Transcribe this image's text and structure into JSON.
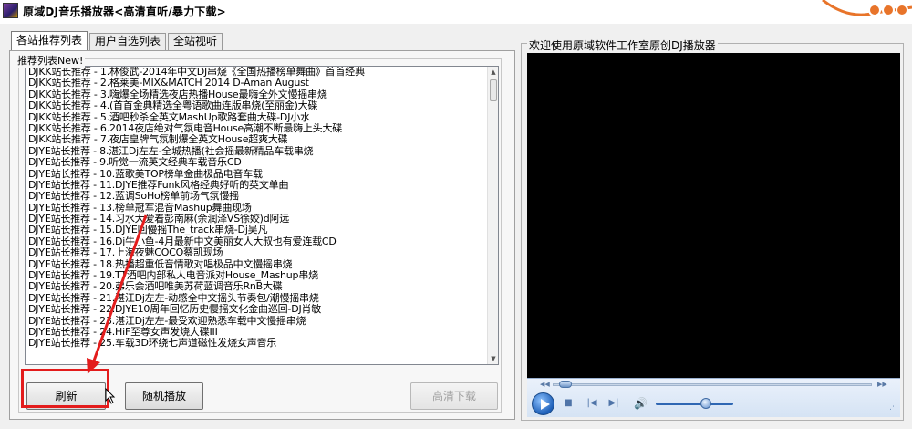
{
  "window": {
    "title": "原域DJ音乐播放器<高清直听/暴力下载>"
  },
  "tabs": [
    {
      "label": "各站推荐列表",
      "active": true
    },
    {
      "label": "用户自选列表",
      "active": false
    },
    {
      "label": "全站视听",
      "active": false
    }
  ],
  "list_group": {
    "legend": "推荐列表New!",
    "items": [
      "DJKK站长推荐 - 1.林俊武-2014年中文DJ串烧《全国热播榜单舞曲》首首经典",
      "DJKK站长推荐 - 2.格莱美-MIX&MATCH 2014 D-Aman August",
      "DJKK站长推荐 - 3.嗨爆全场精选夜店热播House最嗨全外文慢摇串烧",
      "DJKK站长推荐 - 4.(首首金典精选全粤语歌曲连版串烧(至丽金)大碟",
      "DJKK站长推荐 - 5.酒吧秒杀全英文MashUp歌路套曲大碟-DJ小水",
      "DJKK站长推荐 - 6.2014夜店绝对气氛电音House高潮不断最嗨上头大碟",
      "DJKK站长推荐 - 7.夜店皇牌气氛制爆全英文House超爽大碟",
      "DJYE站长推荐 - 8.湛江Dj左左-全城热播(社会摇最新精品车载串烧",
      "DJYE站长推荐 - 9.听觉一流英文经典车载音乐CD",
      "DJYE站长推荐 - 10.蓝歌美TOP榜单金曲极品电音车载",
      "DJYE站长推荐 - 11.DJYE推荐Funk风格经典好听的英文单曲",
      "DJYE站长推荐 - 12.蓝调SoHo榜单前场气氛慢摇",
      "DJYE站长推荐 - 13.榜单冠军混音Mashup舞曲现场",
      "DJYE站长推荐 - 14.习水大爱着彭南麻(余润泽VS徐姣)d阿远",
      "DJYE站长推荐 - 15.DJYE回慢摇The_track串烧-Dj吴凡",
      "DJYE站长推荐 - 16.Dj牛小鱼-4月最新中文美丽女人大叔也有爱连载CD",
      "DJYE站长推荐 - 17.上海夜魅COCO蔡凯现场",
      "DJYE站长推荐 - 18.热播超重低音情歌对唱极品中文慢摇串烧",
      "DJYE站长推荐 - 19.TT酒吧内部私人电音派对House_Mashup串烧",
      "DJYE站长推荐 - 20.弗乐会酒吧唯美苏荷蓝调音乐RnB大碟",
      "DJYE站长推荐 - 21.湛江Dj左左-动感全中文摇头节奏包/潮慢摇串烧",
      "DJYE站长推荐 - 22.DJYE10周年回忆历史慢摇文化金曲巡回-DJ肖敏",
      "DJYE站长推荐 - 23.湛江Dj左左-最受欢迎熟悉车载中文慢摇串烧",
      "DJYE站长推荐 - 24.HiF至尊女声发烧大碟III",
      "DJYE站长推荐 - 25.车载3D环绕七声道磁性发烧女声音乐"
    ]
  },
  "buttons": {
    "refresh": "刷新",
    "random": "随机播放",
    "download": "高清下载"
  },
  "player": {
    "title": "欢迎使用原域软件工作室原创DJ播放器",
    "seek_progress": 0.02,
    "volume": 0.65
  },
  "icons": {
    "app": "app-logo-icon",
    "play": "play-icon",
    "stop": "stop-icon",
    "prev": "previous-icon",
    "next": "next-icon",
    "volume": "speaker-icon",
    "cursor": "mouse-pointer-icon"
  },
  "colors": {
    "annotation_red": "#e31c1c",
    "video_bg": "#000000",
    "accent_orange": "#e8742a"
  }
}
